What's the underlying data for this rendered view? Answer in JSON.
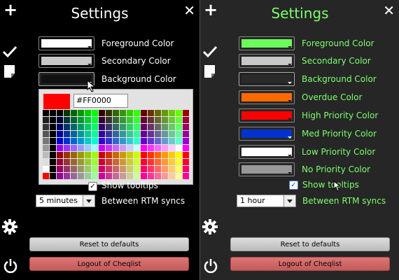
{
  "colors": {
    "left_bg": "#000000",
    "right_bg": "#262626",
    "green_label": "#7dff6e",
    "white_label": "#ffffff",
    "reset_btn": "#cccccc",
    "logout_btn": "#d06464"
  },
  "icons": {
    "add": "plus-icon",
    "close": "close-icon",
    "done": "check-icon",
    "note": "note-icon",
    "settings": "gear-icon",
    "power": "power-icon"
  },
  "left": {
    "title": "Settings",
    "rows": [
      {
        "label": "Foreground Color",
        "color": "#ffffff"
      },
      {
        "label": "Secondary Color",
        "color": "#c8c8c8"
      },
      {
        "label": "Background Color",
        "color": "#111111"
      }
    ],
    "picker": {
      "selected_color": "#ff0000",
      "hex_value": "#FF0000"
    },
    "show_tooltips": {
      "label": "Show tooltips",
      "checked": true
    },
    "sync": {
      "value": "5 minutes",
      "label": "Between RTM syncs"
    },
    "reset_label": "Reset to defaults",
    "logout_label": "Logout of Cheqlist"
  },
  "right": {
    "title": "Settings",
    "rows": [
      {
        "label": "Foreground Color",
        "color": "#6cff5c"
      },
      {
        "label": "Secondary Color",
        "color": "#c8c8c8"
      },
      {
        "label": "Background Color",
        "color": "#2a2a2a"
      },
      {
        "label": "Overdue Color",
        "color": "#ff6a00"
      },
      {
        "label": "High Priority Color",
        "color": "#ff0000"
      },
      {
        "label": "Med Priority Color",
        "color": "#0033cc"
      },
      {
        "label": "Low Priority Color",
        "color": "#ffffff"
      },
      {
        "label": "No Priority Color",
        "color": "#999999"
      }
    ],
    "show_tooltips": {
      "label": "Show tooltips",
      "checked": true
    },
    "sync": {
      "value": "1 hour",
      "label": "Between RTM syncs"
    },
    "reset_label": "Reset to defaults",
    "logout_label": "Logout of Cheqlist"
  }
}
